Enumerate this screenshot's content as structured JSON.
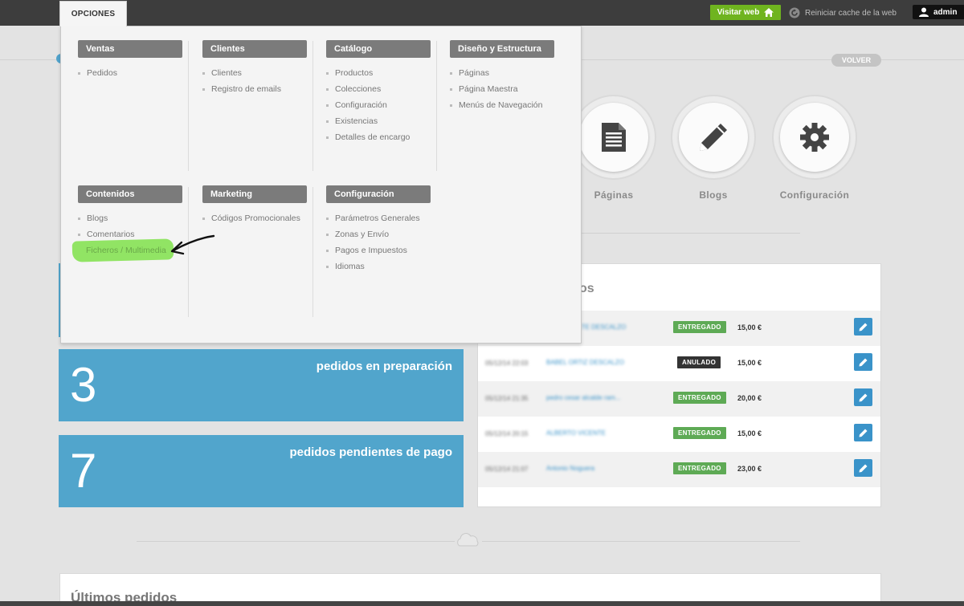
{
  "topbar": {
    "options_label": "OPCIONES",
    "visit_label": "Visitar web",
    "cache_label": "Reiniciar cache de la web",
    "user_label": "admin"
  },
  "volver_label": "VOLVER",
  "shortcuts": [
    {
      "label": "Páginas",
      "icon": "document-icon"
    },
    {
      "label": "Blogs",
      "icon": "pencil-icon"
    },
    {
      "label": "Configuración",
      "icon": "gear-icon"
    }
  ],
  "stats": [
    {
      "number": "3",
      "label": "pedidos en preparación"
    },
    {
      "number": "7",
      "label": "pedidos pendientes de pago"
    }
  ],
  "orders": {
    "title": "os",
    "rows": [
      {
        "date": "",
        "name": "...TE DESCALZO",
        "status": "ENTREGADO",
        "amount": "15,00 €"
      },
      {
        "date": "05/12/14 22:03",
        "name": "BABEL ORTIZ DESCALZO",
        "status": "ANULADO",
        "amount": "15,00 €"
      },
      {
        "date": "05/12/14 21:35",
        "name": "pedro cesar alcalde ram...",
        "status": "ENTREGADO",
        "amount": "20,00 €"
      },
      {
        "date": "05/12/14 20:15",
        "name": "ALBERTO VICENTE",
        "status": "ENTREGADO",
        "amount": "15,00 €"
      },
      {
        "date": "05/12/14 21:07",
        "name": "Antonio Noguera",
        "status": "ENTREGADO",
        "amount": "23,00 €"
      }
    ]
  },
  "bottom_title": "Últimos pedidos",
  "menu": {
    "ventas": {
      "title": "Ventas",
      "items": [
        "Pedidos"
      ]
    },
    "clientes": {
      "title": "Clientes",
      "items": [
        "Clientes",
        "Registro de emails"
      ]
    },
    "catalogo": {
      "title": "Catálogo",
      "items": [
        "Productos",
        "Colecciones",
        "Configuración",
        "Existencias",
        "Detalles de encargo"
      ]
    },
    "diseno": {
      "title": "Diseño y Estructura",
      "items": [
        "Páginas",
        "Página Maestra",
        "Menús de Navegación"
      ]
    },
    "contenidos": {
      "title": "Contenidos",
      "items": [
        "Blogs",
        "Comentarios",
        "Ficheros / Multimedia"
      ]
    },
    "marketing": {
      "title": "Marketing",
      "items": [
        "Códigos Promocionales"
      ]
    },
    "configuracion": {
      "title": "Configuración",
      "items": [
        "Parámetros Generales",
        "Zonas y Envío",
        "Pagos e Impuestos",
        "Idiomas"
      ]
    }
  },
  "colors": {
    "accent_blue": "#51a5cc",
    "visit_green": "#6fb41f",
    "status_green": "#5eaa55",
    "highlight": "#7fe14a"
  }
}
